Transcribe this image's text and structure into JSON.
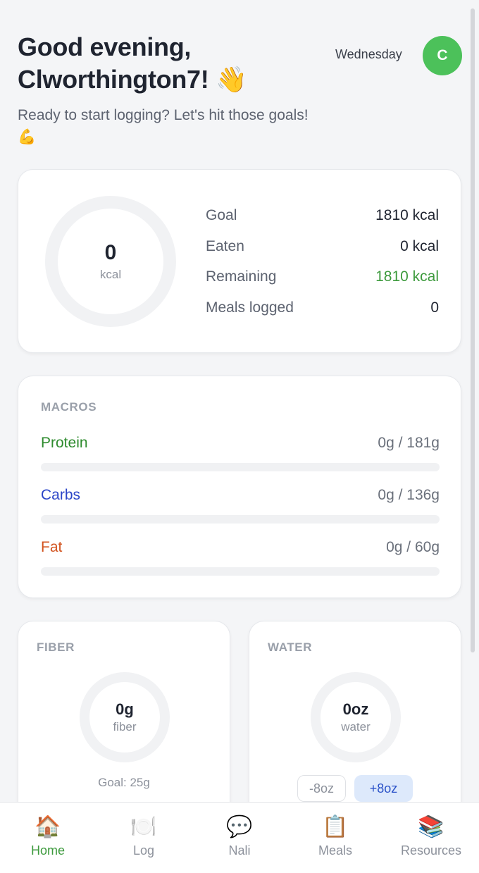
{
  "header": {
    "greeting": "Good evening, Clworthington7! 👋",
    "subtitle": "Ready to start logging? Let's hit those goals! 💪",
    "day": "Wednesday",
    "avatar_initial": "C"
  },
  "calories": {
    "ring_value": "0",
    "ring_unit": "kcal",
    "rows": [
      {
        "label": "Goal",
        "value": "1810 kcal"
      },
      {
        "label": "Eaten",
        "value": "0 kcal"
      },
      {
        "label": "Remaining",
        "value": "1810 kcal"
      },
      {
        "label": "Meals logged",
        "value": "0"
      }
    ]
  },
  "macros": {
    "title": "MACROS",
    "items": [
      {
        "label": "Protein",
        "value": "0g / 181g",
        "progress": 0,
        "color": "#2e8b2e"
      },
      {
        "label": "Carbs",
        "value": "0g / 136g",
        "progress": 0,
        "color": "#2b45c8"
      },
      {
        "label": "Fat",
        "value": "0g / 60g",
        "progress": 0,
        "color": "#d2531f"
      }
    ]
  },
  "fiber": {
    "title": "FIBER",
    "value": "0g",
    "unit": "fiber",
    "goal": "Goal: 25g"
  },
  "water": {
    "title": "WATER",
    "value": "0oz",
    "unit": "water",
    "minus_label": "-8oz",
    "plus_label": "+8oz"
  },
  "nav": {
    "items": [
      {
        "label": "Home",
        "icon": "🏠",
        "active": true
      },
      {
        "label": "Log",
        "icon": "🍽️"
      },
      {
        "label": "Nali",
        "icon": "💬"
      },
      {
        "label": "Meals",
        "icon": "📋"
      },
      {
        "label": "Resources",
        "icon": "📚"
      }
    ]
  },
  "colors": {
    "accent_green": "#4cc15a",
    "remaining_green": "#3d9a3d"
  }
}
